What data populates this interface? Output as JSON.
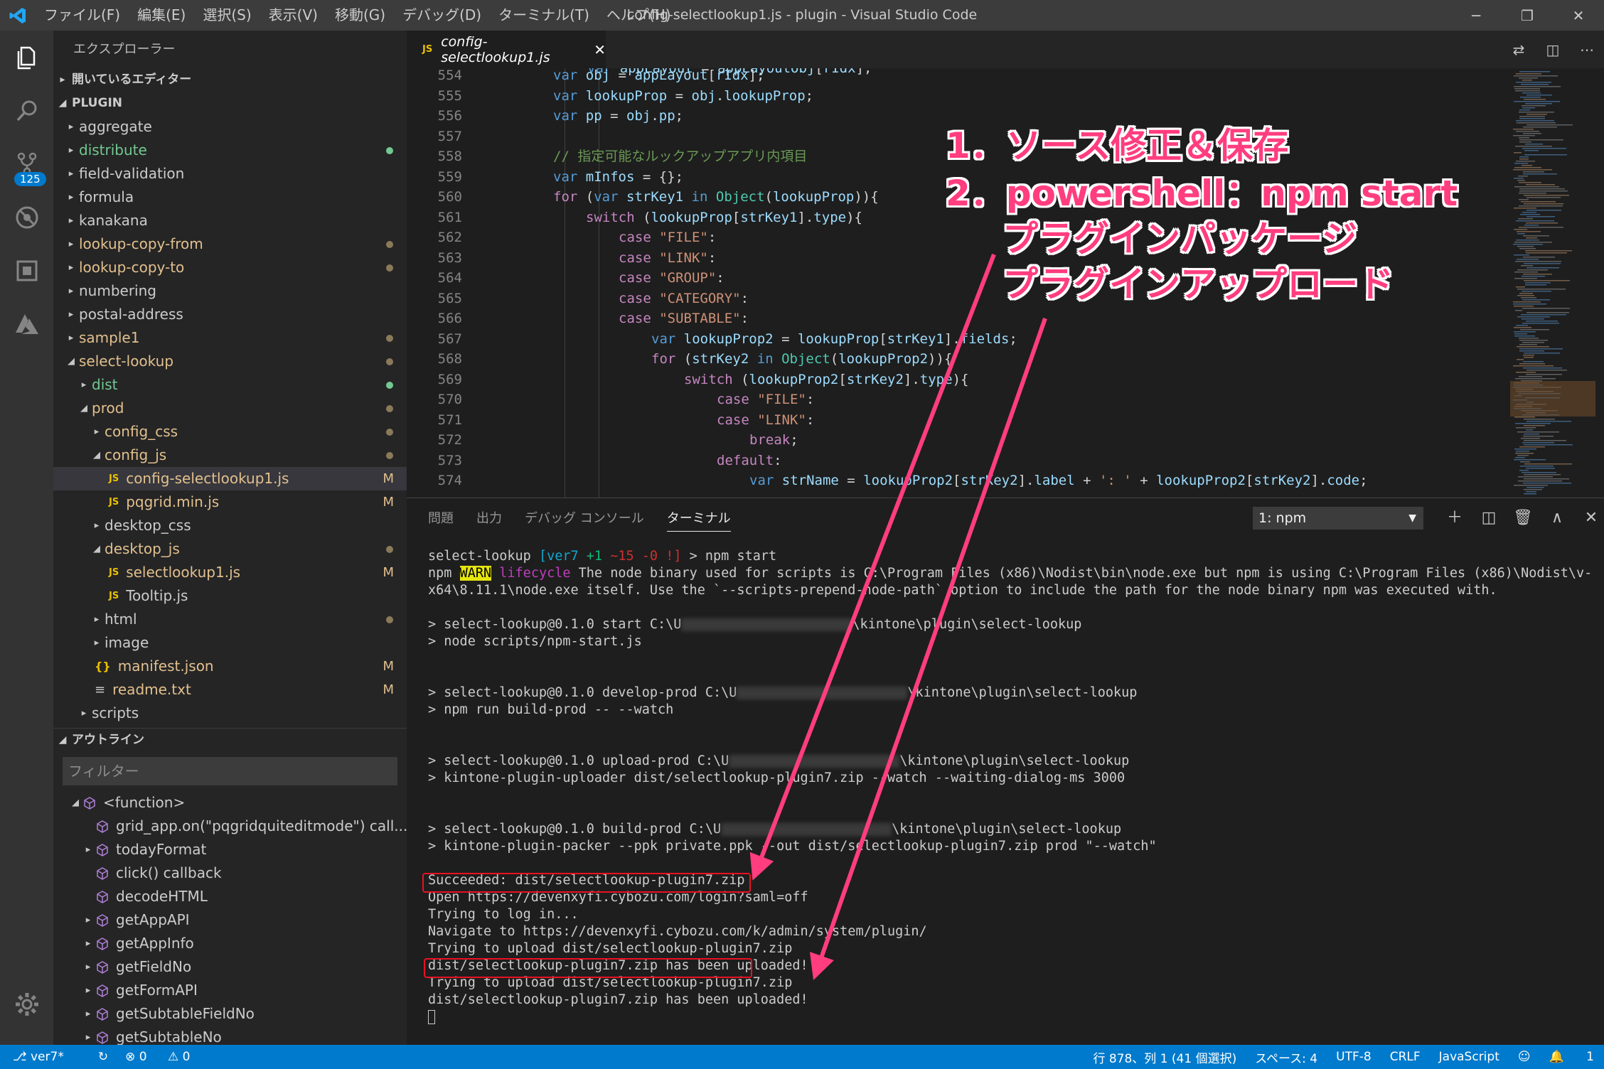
{
  "titlebar": {
    "menu": [
      "ファイル(F)",
      "編集(E)",
      "選択(S)",
      "表示(V)",
      "移動(G)",
      "デバッグ(D)",
      "ターミナル(T)",
      "ヘルプ(H)"
    ],
    "title": "config-selectlookup1.js - plugin - Visual Studio Code"
  },
  "activity": {
    "scm_badge": "125"
  },
  "sidebar": {
    "title": "エクスプローラー",
    "open_editors": "開いているエディター",
    "root": "PLUGIN",
    "tree": [
      {
        "label": "aggregate",
        "deco": ""
      },
      {
        "label": "distribute",
        "deco": "dot-green"
      },
      {
        "label": "field-validation",
        "deco": ""
      },
      {
        "label": "formula",
        "deco": ""
      },
      {
        "label": "kanakana",
        "deco": ""
      },
      {
        "label": "lookup-copy-from",
        "deco": "dot"
      },
      {
        "label": "lookup-copy-to",
        "deco": "dot"
      },
      {
        "label": "numbering",
        "deco": ""
      },
      {
        "label": "postal-address",
        "deco": ""
      },
      {
        "label": "sample1",
        "deco": "dot"
      },
      {
        "label": "select-lookup",
        "deco": "dot"
      },
      {
        "label": "dist",
        "deco": "dot-green"
      },
      {
        "label": "prod",
        "deco": "dot"
      },
      {
        "label": "config_css",
        "deco": "dot"
      },
      {
        "label": "config_js",
        "deco": "dot"
      },
      {
        "label": "config-selectlookup1.js",
        "deco": "M"
      },
      {
        "label": "pqgrid.min.js",
        "deco": "M"
      },
      {
        "label": "desktop_css",
        "deco": ""
      },
      {
        "label": "desktop_js",
        "deco": "dot"
      },
      {
        "label": "selectlookup1.js",
        "deco": "M"
      },
      {
        "label": "Tooltip.js",
        "deco": ""
      },
      {
        "label": "html",
        "deco": "dot"
      },
      {
        "label": "image",
        "deco": ""
      },
      {
        "label": "manifest.json",
        "deco": "M"
      },
      {
        "label": "readme.txt",
        "deco": "M"
      },
      {
        "label": "scripts",
        "deco": ""
      }
    ],
    "outline_title": "アウトライン",
    "filter_placeholder": "フィルター",
    "outline": [
      "<function>",
      "grid_app.on(\"pqgridquiteditmode\") call...",
      "todayFormat",
      "click() callback",
      "decodeHTML",
      "getAppAPI",
      "getAppInfo",
      "getFieldNo",
      "getFormAPI",
      "getSubtableFieldNo",
      "getSubtableNo"
    ]
  },
  "editor": {
    "tab_label": "config-selectlookup1.js",
    "icon_label": "JS",
    "line_numbers": [
      "554",
      "555",
      "556",
      "557",
      "558",
      "559",
      "560",
      "561",
      "562",
      "563",
      "564",
      "565",
      "566",
      "567",
      "568",
      "569",
      "570",
      "571",
      "572",
      "573",
      "574"
    ]
  },
  "annotation": {
    "line1": "1．ソース修正＆保存",
    "line2": "2．powershell：npm start",
    "line3": "プラグインパッケージ",
    "line4": "プラグインアップロード"
  },
  "panel": {
    "tabs": [
      "問題",
      "出力",
      "デバッグ コンソール",
      "ターミナル"
    ],
    "terminal_select": "1: npm",
    "terminal": {
      "prompt_dir": "select-lookup",
      "prompt_branch": "[ver7",
      "prompt_plus": "+1",
      "prompt_tilde": "~15",
      "prompt_minus": "-0",
      "prompt_bang": "!]",
      "prompt_arrow": ">",
      "prompt_cmd": "npm start",
      "warn_npm": "npm",
      "warn_tag": "WARN",
      "warn_lifecycle": "lifecycle",
      "warn_text1": " The node binary used for scripts is C:\\Program Files (x86)\\Nodist\\bin\\node.exe but npm is using C:\\Program Files (x86)\\Nodist\\v-",
      "warn_text2": "x64\\8.11.1\\node.exe itself. Use the `--scripts-prepend-node-path` option to include the path for the node binary npm was executed with.",
      "start_a": "> select-lookup@0.1.0 start C:\\U",
      "start_b": "\\kintone\\plugin\\select-lookup",
      "start_cmd": "> node scripts/npm-start.js",
      "dev_a": "> select-lookup@0.1.0 develop-prod C:\\U",
      "dev_b": "\\kintone\\plugin\\select-lookup",
      "dev_cmd": "> npm run build-prod -- --watch",
      "up_a": "> select-lookup@0.1.0 upload-prod C:\\U",
      "up_b": "\\kintone\\plugin\\select-lookup",
      "up_cmd": "> kintone-plugin-uploader dist/selectlookup-plugin7.zip --watch --waiting-dialog-ms 3000",
      "build_a": "> select-lookup@0.1.0 build-prod C:\\U",
      "build_b": "\\kintone\\plugin\\select-lookup",
      "build_cmd": "> kintone-plugin-packer --ppk private.ppk --out dist/selectlookup-plugin7.zip prod \"--watch\"",
      "succeeded": "Succeeded: dist/selectlookup-plugin7.zip",
      "open": "Open https://devenxyfi.cybozu.com/login?saml=off",
      "trying_login": "Trying to log in...",
      "navigate": "Navigate to https://devenxyfi.cybozu.com/k/admin/system/plugin/",
      "trying_upload1": "Trying to upload dist/selectlookup-plugin7.zip",
      "uploaded1": "dist/selectlookup-plugin7.zip has been uploaded!",
      "trying_upload2": "Trying to upload dist/selectlookup-plugin7.zip",
      "uploaded2": "dist/selectlookup-plugin7.zip has been uploaded!"
    }
  },
  "status": {
    "branch": "ver7*",
    "errors": "0",
    "warnings": "0",
    "position": "行 878、列 1 (41 個選択)",
    "spaces": "スペース: 4",
    "encoding": "UTF-8",
    "eol": "CRLF",
    "language": "JavaScript",
    "notifications": "1"
  },
  "colors": {
    "accent": "#007acc",
    "annotation": "#ff3d7f",
    "highlight_box": "#e81123"
  }
}
